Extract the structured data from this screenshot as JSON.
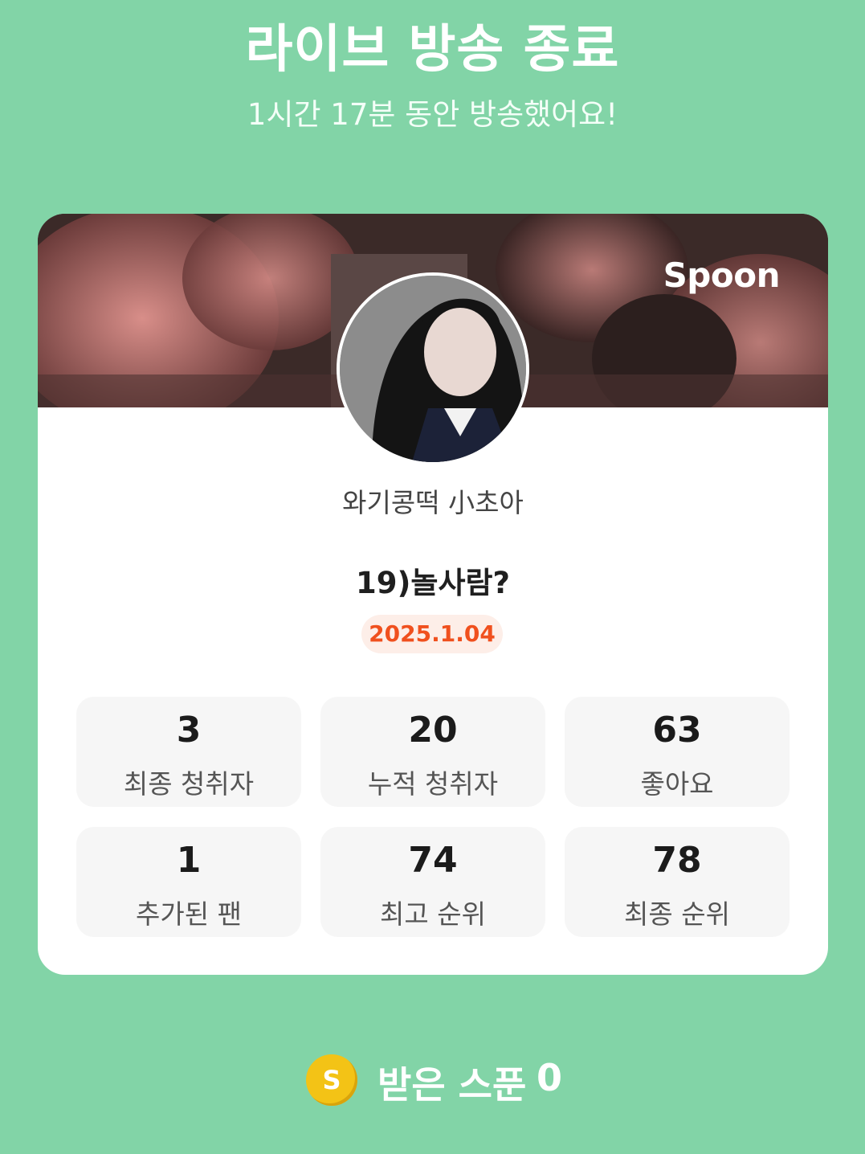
{
  "header": {
    "title": "라이브 방송 종료",
    "subtitle": "1시간 17분 동안 방송했어요!"
  },
  "card": {
    "brand": "Spoon",
    "nickname": "와기콩떡 小초아",
    "broadcast_title": "19)놀사람?",
    "date": "2025.1.04",
    "stats": [
      {
        "value": "3",
        "label": "최종 청취자"
      },
      {
        "value": "20",
        "label": "누적 청취자"
      },
      {
        "value": "63",
        "label": "좋아요"
      },
      {
        "value": "1",
        "label": "추가된 팬"
      },
      {
        "value": "74",
        "label": "최고 순위"
      },
      {
        "value": "78",
        "label": "최종 순위"
      }
    ]
  },
  "spoons": {
    "coin_symbol": "S",
    "label": "받은 스푼",
    "value": "0"
  },
  "colors": {
    "background": "#82d4a7",
    "accent": "#f0501e",
    "badge_bg": "#fdeee8"
  },
  "icons": {
    "coin": "spoon-coin-icon",
    "avatar": "profile-avatar"
  }
}
